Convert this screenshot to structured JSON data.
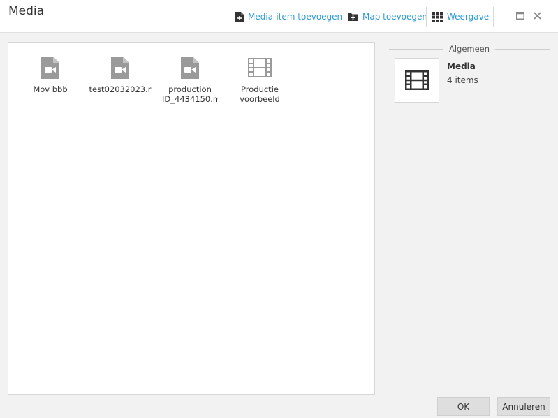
{
  "window": {
    "title": "Media"
  },
  "toolbar": {
    "add_media_label": "Media-item toevoegen",
    "add_folder_label": "Map toevoegen",
    "view_label": "Weergave"
  },
  "items": [
    {
      "label": "Mov bbb",
      "icon": "video-file-icon"
    },
    {
      "label": "test02032023.r",
      "icon": "video-file-icon"
    },
    {
      "label": "production ID_4434150.m",
      "icon": "video-file-icon"
    },
    {
      "label": "Productie voorbeeld",
      "icon": "film-folder-icon"
    }
  ],
  "sidebar": {
    "heading": "Algemeen",
    "name": "Media",
    "count": "4 items"
  },
  "buttons": {
    "ok_label": "OK",
    "cancel_label": "Annuleren"
  },
  "colors": {
    "accent": "#2e9bd3",
    "icon_gray": "#9a9a9a",
    "icon_dark": "#333333"
  }
}
